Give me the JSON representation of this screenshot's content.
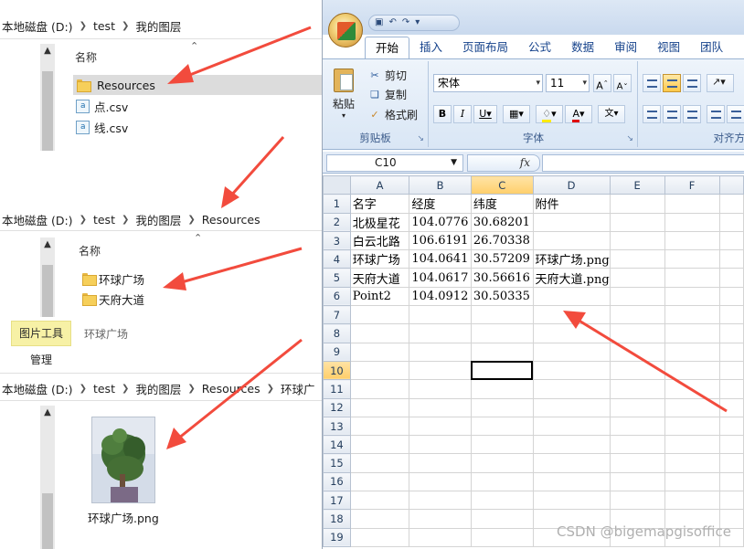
{
  "explorer1": {
    "breadcrumb": [
      "本地磁盘 (D:)",
      "test",
      "我的图层"
    ],
    "column_header": "名称",
    "items": [
      {
        "name": "Resources",
        "type": "folder",
        "selected": true
      },
      {
        "name": "点.csv",
        "type": "csv",
        "selected": false
      },
      {
        "name": "线.csv",
        "type": "csv",
        "selected": false
      }
    ]
  },
  "explorer2": {
    "breadcrumb": [
      "本地磁盘 (D:)",
      "test",
      "我的图层",
      "Resources"
    ],
    "column_header": "名称",
    "items": [
      {
        "name": "环球广场",
        "type": "folder"
      },
      {
        "name": "天府大道",
        "type": "folder"
      }
    ]
  },
  "explorer3": {
    "ribbon_context": "图片工具",
    "ribbon_title": "环球广场",
    "ribbon_tab": "管理",
    "breadcrumb": [
      "本地磁盘 (D:)",
      "test",
      "我的图层",
      "Resources",
      "环球广"
    ],
    "file": {
      "name": "环球广场.png",
      "type": "image"
    }
  },
  "excel": {
    "tabs": [
      "开始",
      "插入",
      "页面布局",
      "公式",
      "数据",
      "审阅",
      "视图",
      "团队"
    ],
    "active_tab": "开始",
    "clipboard": {
      "paste": "粘贴",
      "cut": "剪切",
      "copy": "复制",
      "format_painter": "格式刷",
      "label": "剪贴板"
    },
    "font": {
      "name": "宋体",
      "size": "11",
      "label": "字体"
    },
    "alignment": {
      "label": "对齐方"
    },
    "namebox": "C10",
    "fx": "fx",
    "columns": [
      "A",
      "B",
      "C",
      "D",
      "E",
      "F"
    ],
    "selected_column": "C",
    "selected_row": 10,
    "rows": [
      [
        "名字",
        "经度",
        "纬度",
        "附件",
        "",
        ""
      ],
      [
        "北极星花",
        "104.0776",
        "30.68201",
        "",
        "",
        ""
      ],
      [
        "白云北路",
        "106.6191",
        "26.70338",
        "",
        "",
        ""
      ],
      [
        "环球广场",
        "104.0641",
        "30.57209",
        "环球广场.png",
        "",
        ""
      ],
      [
        "天府大道",
        "104.0617",
        "30.56616",
        "天府大道.png",
        "",
        ""
      ],
      [
        "Point2",
        "104.0912",
        "30.50335",
        "",
        "",
        ""
      ],
      [
        "",
        "",
        "",
        "",
        "",
        ""
      ],
      [
        "",
        "",
        "",
        "",
        "",
        ""
      ],
      [
        "",
        "",
        "",
        "",
        "",
        ""
      ],
      [
        "",
        "",
        "",
        "",
        "",
        ""
      ],
      [
        "",
        "",
        "",
        "",
        "",
        ""
      ],
      [
        "",
        "",
        "",
        "",
        "",
        ""
      ],
      [
        "",
        "",
        "",
        "",
        "",
        ""
      ],
      [
        "",
        "",
        "",
        "",
        "",
        ""
      ],
      [
        "",
        "",
        "",
        "",
        "",
        ""
      ],
      [
        "",
        "",
        "",
        "",
        "",
        ""
      ],
      [
        "",
        "",
        "",
        "",
        "",
        ""
      ],
      [
        "",
        "",
        "",
        "",
        "",
        ""
      ],
      [
        "",
        "",
        "",
        "",
        "",
        ""
      ]
    ]
  },
  "watermark": "CSDN @bigemapgisoffice",
  "colors": {
    "arrow": "#f24b3d",
    "selected_header": "#ffcf6b",
    "ribbon": "#d9e6f5"
  }
}
